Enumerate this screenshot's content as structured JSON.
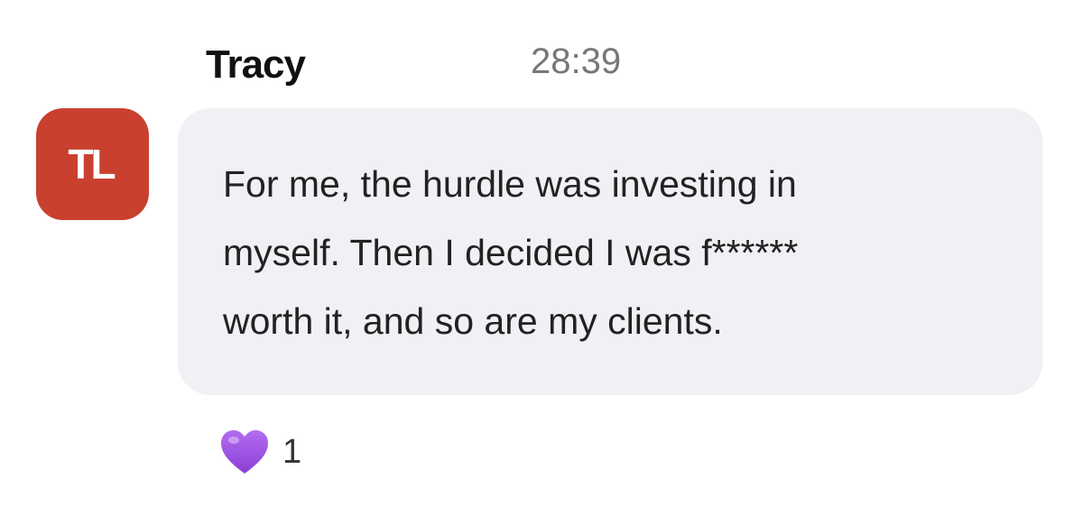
{
  "message": {
    "sender": "Tracy",
    "avatar_initials": "TL",
    "avatar_color": "#c9412e",
    "timestamp": "28:39",
    "text": "For me, the hurdle was investing in\nmyself. Then I decided I was f******\nworth it, and so are my clients.",
    "bubble_color": "#f1f0f4"
  },
  "reactions": [
    {
      "icon": "purple-heart-icon",
      "count": "1",
      "color": "#9b4fe0"
    }
  ]
}
